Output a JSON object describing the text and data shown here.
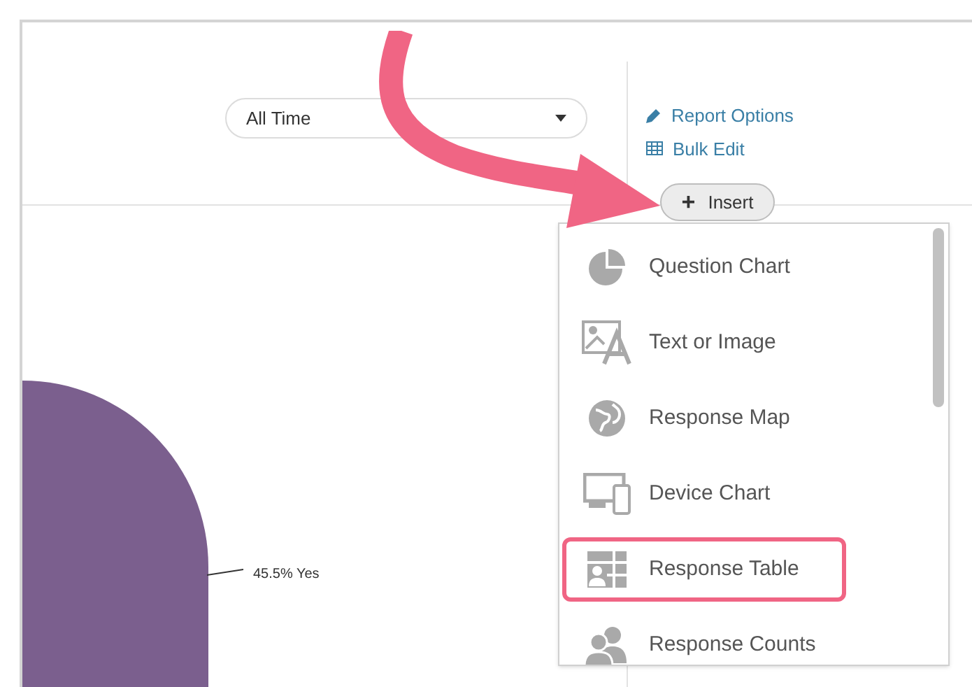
{
  "date_filter": {
    "value": "All Time"
  },
  "links": [
    {
      "kind": "edit",
      "label": "Report Options"
    },
    {
      "kind": "table",
      "label": "Bulk Edit"
    }
  ],
  "insert_button": {
    "icon": "+",
    "label": "Insert"
  },
  "insert_menu": [
    {
      "kind": "pie",
      "label": "Question Chart",
      "highlighted": false
    },
    {
      "kind": "textimage",
      "label": "Text or Image",
      "highlighted": false
    },
    {
      "kind": "globe",
      "label": "Response Map",
      "highlighted": false
    },
    {
      "kind": "device",
      "label": "Device Chart",
      "highlighted": false
    },
    {
      "kind": "table",
      "label": "Response Table",
      "highlighted": true
    },
    {
      "kind": "people",
      "label": "Response Counts",
      "highlighted": false
    }
  ],
  "pie": {
    "label": "45.5% Yes"
  }
}
